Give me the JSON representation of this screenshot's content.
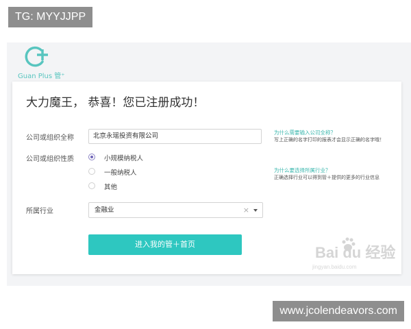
{
  "tag_top": "TG: MYYJJPP",
  "tag_bottom": "www.jcolendeavors.com",
  "logo": {
    "text": "Guan Plus 管⁺",
    "icon": "guanplus-logo-icon"
  },
  "title": "大力魔王， 恭喜！您已注册成功！",
  "form": {
    "company_label": "公司或组织全称",
    "company_value": "北京永瑶投资有限公司",
    "nature_label": "公司或组织性质",
    "nature_options": [
      {
        "label": "小规模纳税人",
        "checked": true
      },
      {
        "label": "一般纳税人",
        "checked": false
      },
      {
        "label": "其他",
        "checked": false
      }
    ],
    "industry_label": "所属行业",
    "industry_value": "金融业",
    "submit_label": "进入我的管＋首页"
  },
  "help": {
    "q1": "为什么需要输入公司全称？",
    "a1": "写上正确的名字打印的报表才会显示正确的名字哦！",
    "q2": "为什么要选择所属行业？",
    "a2": "正确选择行业可以得到管＋提供的更多的行业信息"
  },
  "watermark": {
    "main": "Bai du 经验",
    "sub": "jingyan.baidu.com"
  },
  "colors": {
    "accent": "#2ec7c0",
    "radio": "#6f64b8",
    "link": "#3bb7ae"
  }
}
